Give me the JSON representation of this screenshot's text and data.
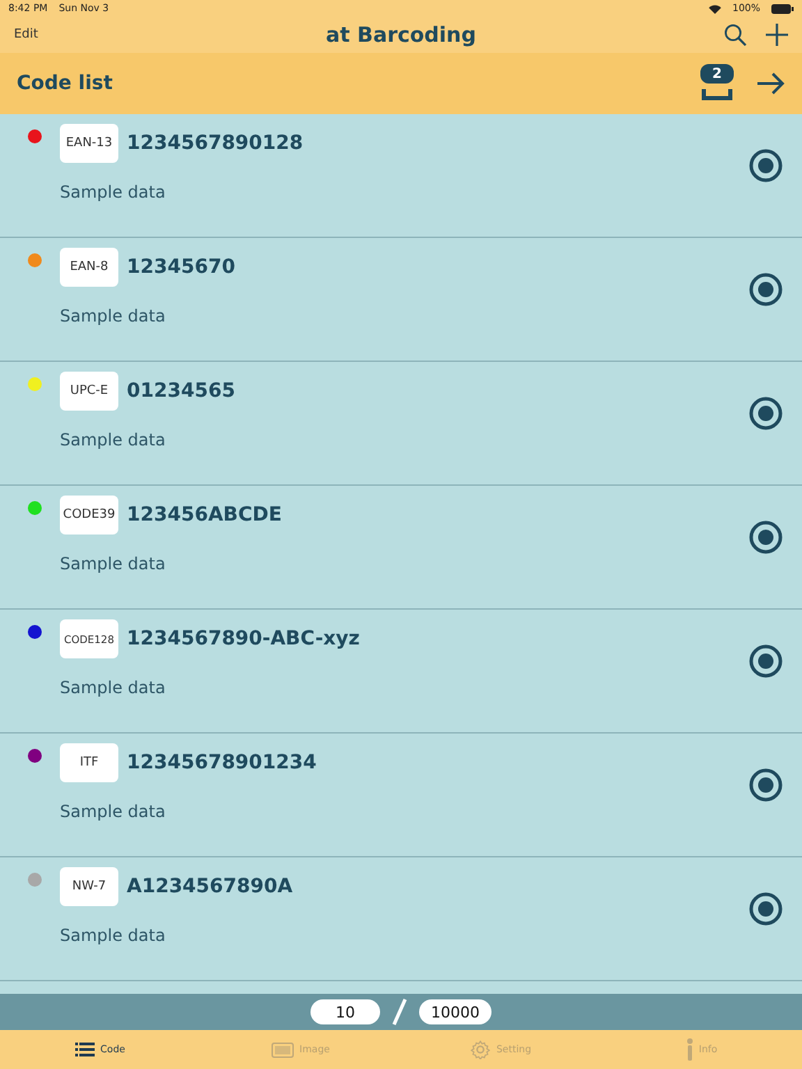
{
  "status_bar": {
    "time": "8:42 PM",
    "date": "Sun Nov 3",
    "battery": "100%"
  },
  "nav_bar": {
    "edit": "Edit",
    "title": "at Barcoding"
  },
  "header": {
    "title": "Code list",
    "badge": "2"
  },
  "codes": [
    {
      "color": "#e8141c",
      "type": "EAN-13",
      "code": "1234567890128",
      "note": "Sample data",
      "selected": true
    },
    {
      "color": "#f08a1c",
      "type": "EAN-8",
      "code": "12345670",
      "note": "Sample data",
      "selected": true
    },
    {
      "color": "#f0f020",
      "type": "UPC-E",
      "code": "01234565",
      "note": "Sample data",
      "selected": true
    },
    {
      "color": "#20e020",
      "type": "CODE39",
      "code": "123456ABCDE",
      "note": "Sample data",
      "selected": true
    },
    {
      "color": "#1414d0",
      "type": "CODE128",
      "code": "1234567890-ABC-xyz",
      "note": "Sample data",
      "selected": true
    },
    {
      "color": "#800080",
      "type": "ITF",
      "code": "12345678901234",
      "note": "Sample data",
      "selected": true
    },
    {
      "color": "#a8a8a8",
      "type": "NW-7",
      "code": "A1234567890A",
      "note": "Sample data",
      "selected": true
    }
  ],
  "pagination": {
    "current": "10",
    "total": "10000"
  },
  "tab_bar": [
    {
      "label": "Code",
      "selected": true
    },
    {
      "label": "Image",
      "selected": false
    },
    {
      "label": "Setting",
      "selected": false
    },
    {
      "label": "Info",
      "selected": false
    }
  ]
}
